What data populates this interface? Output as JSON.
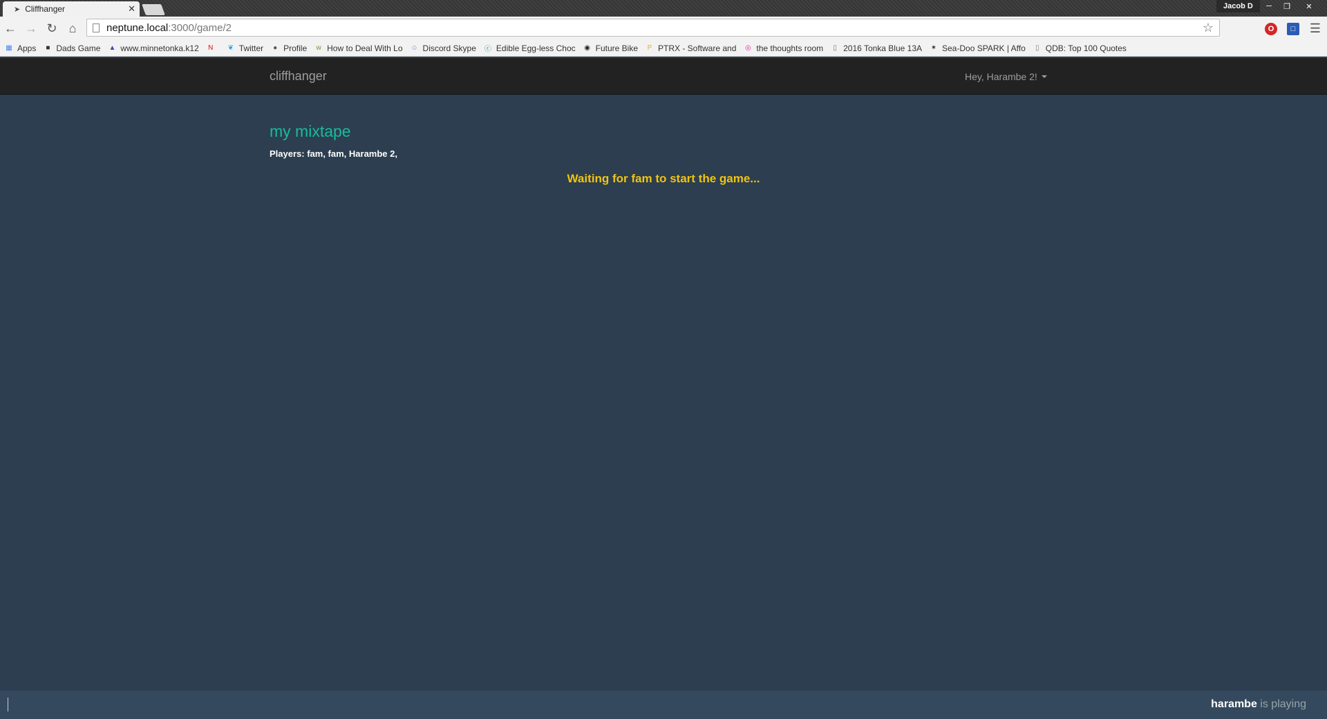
{
  "browser": {
    "tab_title": "Cliffhanger",
    "profile_name": "Jacob D",
    "url_host": "neptune.local",
    "url_rest": ":3000/game/2",
    "bookmarks": [
      {
        "label": "Apps",
        "icon": "apps-grid-icon",
        "color": "#4285f4"
      },
      {
        "label": "Dads Game",
        "icon": "dads-game-icon",
        "color": "#333333"
      },
      {
        "label": "www.minnetonka.k12",
        "icon": "minnetonka-icon",
        "color": "#3a4aa8"
      },
      {
        "label": "",
        "icon": "netflix-icon",
        "color": "#e50914"
      },
      {
        "label": "Twitter",
        "icon": "twitter-icon",
        "color": "#1da1f2"
      },
      {
        "label": "Profile",
        "icon": "profile-icon",
        "color": "#555555"
      },
      {
        "label": "How to Deal With Lo",
        "icon": "wikihow-icon",
        "color": "#6b9a31"
      },
      {
        "label": "Discord Skype",
        "icon": "discord-icon",
        "color": "#7289da"
      },
      {
        "label": "Edible Egg-less Choc",
        "icon": "recipe-icon",
        "color": "#1b8fa3"
      },
      {
        "label": "Future Bike",
        "icon": "future-bike-icon",
        "color": "#222222"
      },
      {
        "label": "PTRX - Software and",
        "icon": "ptrx-icon",
        "color": "#e3b21b"
      },
      {
        "label": "the thoughts room",
        "icon": "thoughts-icon",
        "color": "#e0339a"
      },
      {
        "label": "2016 Tonka Blue 13A",
        "icon": "page-icon",
        "color": "#777777"
      },
      {
        "label": "Sea-Doo SPARK | Affo",
        "icon": "seadoo-icon",
        "color": "#222222"
      },
      {
        "label": "QDB: Top 100 Quotes",
        "icon": "page-icon",
        "color": "#777777"
      }
    ]
  },
  "navbar": {
    "brand": "cliffhanger",
    "user_greeting": "Hey, Harambe 2!"
  },
  "game": {
    "title": "my mixtape",
    "players_text": "Players: fam, fam, Harambe 2,",
    "waiting_text": "Waiting for fam to start the game..."
  },
  "footer": {
    "status_name": "harambe",
    "status_suffix": " is playing"
  },
  "colors": {
    "page_bg": "#2c3e50",
    "title_green": "#18bc9c",
    "waiting_yellow": "#f1c40f",
    "navbar_bg": "#222222"
  }
}
